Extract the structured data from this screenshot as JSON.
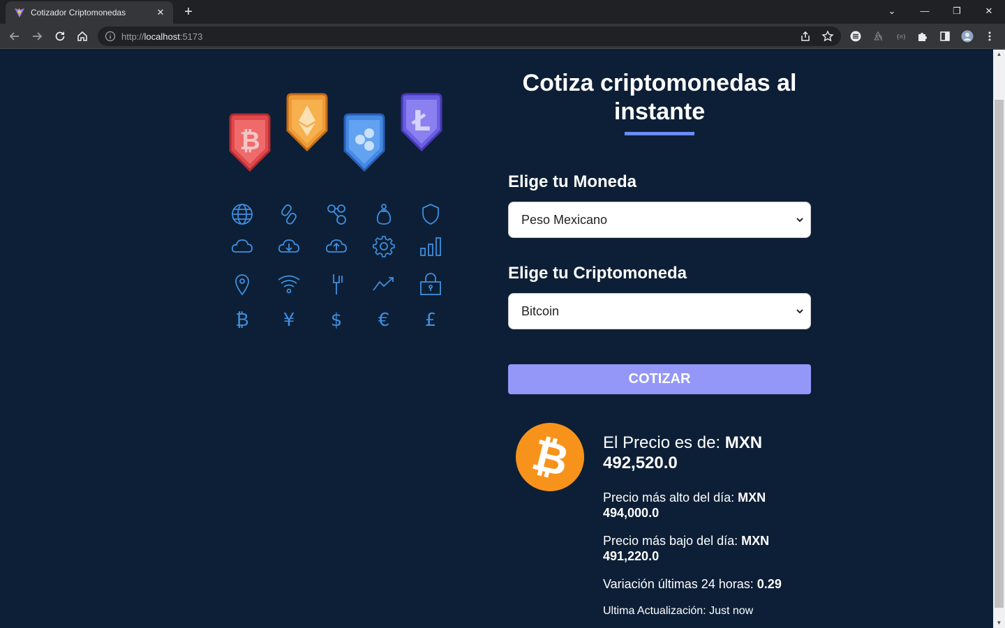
{
  "browser": {
    "tab_title": "Cotizador Criptomonedas",
    "tab_close": "✕",
    "new_tab": "+",
    "url_scheme": "http://",
    "url_host": "localhost",
    "url_port": ":5173",
    "window_controls": {
      "minimize": "—",
      "restore": "❐",
      "close": "✕",
      "tab_search": "⌄"
    }
  },
  "header": {
    "title": "Cotiza criptomonedas al instante",
    "accent_color": "#6b8cf6"
  },
  "form": {
    "currency_label": "Elige tu Moneda",
    "currency_value": "Peso Mexicano",
    "crypto_label": "Elige tu Criptomoneda",
    "crypto_value": "Bitcoin",
    "submit_label": "COTIZAR",
    "submit_color": "#9497f7"
  },
  "result": {
    "coin_icon": "bitcoin-logo",
    "price_label": "El Precio es de:",
    "price_value": "MXN 492,520.0",
    "high_label": "Precio más alto del día:",
    "high_value": "MXN 494,000.0",
    "low_label": "Precio más bajo del día:",
    "low_value": "MXN 491,220.0",
    "change_label": "Variación últimas 24 horas:",
    "change_value": "0.29",
    "updated_label": "Ultima Actualización:",
    "updated_value": "Just now"
  },
  "illustration": {
    "badges": [
      "bitcoin-badge",
      "ethereum-badge",
      "ripple-badge",
      "litecoin-badge"
    ],
    "grid_icons": [
      "globe-icon",
      "link-icon",
      "network-icon",
      "money-bag-icon",
      "shield-icon",
      "cloud-icon",
      "cloud-download-icon",
      "cloud-upload-icon",
      "gear-icon",
      "bar-chart-icon",
      "location-pin-icon",
      "wifi-icon",
      "fork-icon",
      "trend-up-icon",
      "lock-icon",
      "bitcoin-icon",
      "yen-icon",
      "dollar-icon",
      "euro-icon",
      "pound-icon"
    ],
    "icon_color": "#3f8fe0",
    "currency_glyphs": [
      "₿",
      "¥",
      "$",
      "€",
      "£"
    ]
  }
}
